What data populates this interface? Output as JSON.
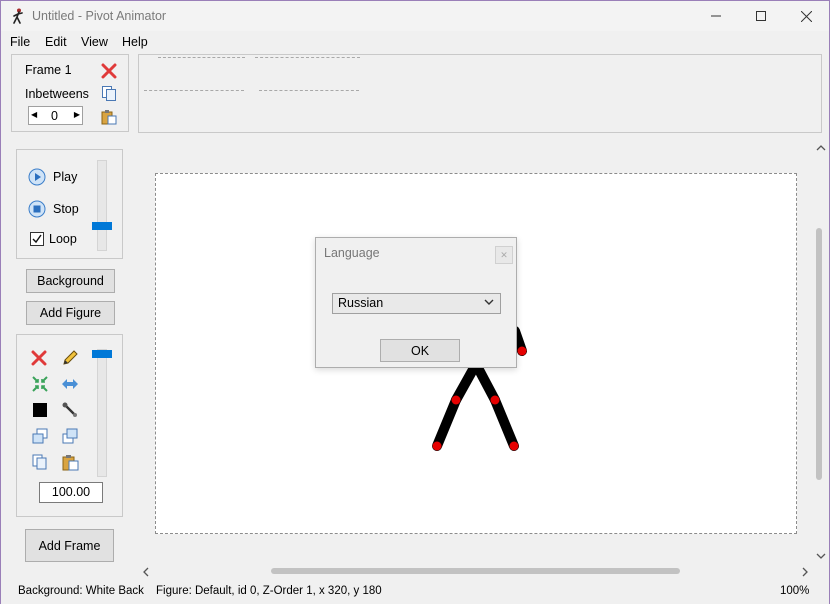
{
  "window": {
    "title": "Untitled - Pivot Animator"
  },
  "menu": {
    "items": [
      "File",
      "Edit",
      "View",
      "Help"
    ]
  },
  "frame_panel": {
    "frame_label": "Frame 1",
    "inbetweens_label": "Inbetweens",
    "inbetweens_value": "0"
  },
  "playback": {
    "play_label": "Play",
    "stop_label": "Stop",
    "loop_label": "Loop",
    "loop_checked": true,
    "speed_level": 0.5
  },
  "buttons": {
    "background_label": "Background",
    "add_figure_label": "Add Figure",
    "add_frame_label": "Add Frame"
  },
  "figure_tools": {
    "scale_value": "100.00",
    "scale_level": 1.0,
    "icons": [
      "delete-icon",
      "pencil-icon",
      "center-icon",
      "flip-icon",
      "color-square-icon",
      "joint-tool-icon",
      "bring-front-icon",
      "send-back-icon",
      "copy-icon",
      "paste-icon"
    ]
  },
  "dialog": {
    "title": "Language",
    "selected_language": "Russian",
    "ok_label": "OK"
  },
  "status": {
    "background": "Background: White Back",
    "figure": "Figure: Default,  id 0,  Z-Order 1,  x 320, y 180",
    "zoom": "100%"
  },
  "colors": {
    "accent": "#0078d7",
    "joint_red": "#e60000",
    "figure_black": "#000000",
    "stage_border": "#8c8c8c"
  }
}
